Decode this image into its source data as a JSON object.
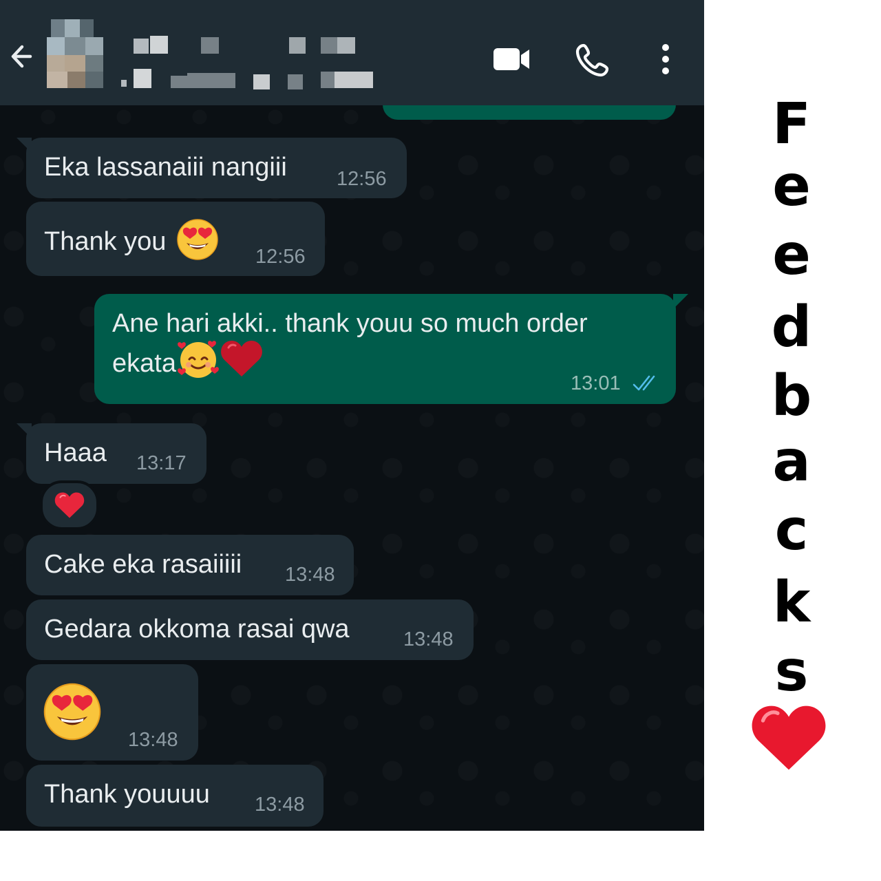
{
  "header": {
    "contact_name": "",
    "contact_status": "",
    "icons": {
      "back": "arrow-left-icon",
      "video": "video-call-icon",
      "call": "phone-call-icon",
      "menu": "more-vert-icon"
    }
  },
  "messages": [
    {
      "direction": "in",
      "text": "Eka lassanaiii nangiii",
      "time": "12:56"
    },
    {
      "direction": "in",
      "text": "Thank you",
      "emoji": "heart-eyes-face",
      "time": "12:56"
    },
    {
      "direction": "out",
      "text": "Ane hari akki.. thank youu so much order",
      "text_line2": "ekata",
      "emoji": [
        "smiling-face-with-hearts",
        "red-heart"
      ],
      "time": "13:01",
      "status": "read"
    },
    {
      "direction": "in",
      "text": "Haaa",
      "time": "13:17",
      "reaction": "red-heart"
    },
    {
      "direction": "in",
      "text": "Cake eka rasaiiiii",
      "time": "13:48"
    },
    {
      "direction": "in",
      "text": "Gedara okkoma rasai qwa",
      "time": "13:48"
    },
    {
      "direction": "in",
      "text": "",
      "emoji": "heart-eyes-face",
      "time": "13:48"
    },
    {
      "direction": "in",
      "text": "Thank youuuu",
      "time": "13:48"
    }
  ],
  "side_title": {
    "letters": [
      "F",
      "e",
      "e",
      "d",
      "b",
      "a",
      "c",
      "k",
      "s"
    ],
    "icon": "red-heart-icon"
  },
  "colors": {
    "chat_background": "#0b1014",
    "header_background": "#1f2c34",
    "incoming_bubble": "#1f2c34",
    "outgoing_bubble": "#005c4b",
    "read_check": "#53bdeb"
  }
}
